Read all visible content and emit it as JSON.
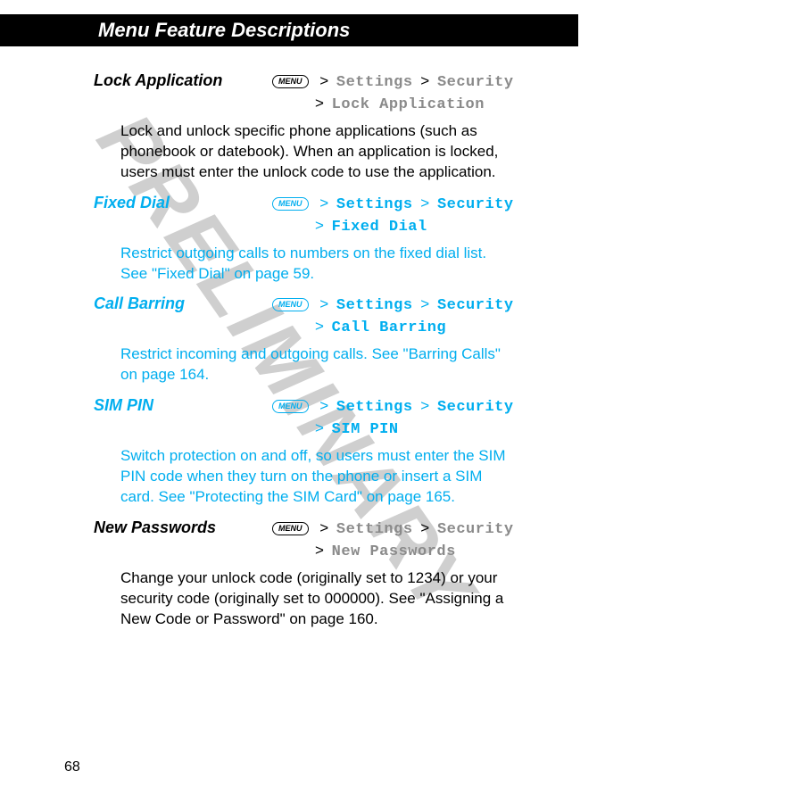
{
  "header": {
    "title": "Menu Feature Descriptions"
  },
  "menu_label": "MENU",
  "sep": ">",
  "watermark": "PRELIMINARY",
  "page_number": "68",
  "entries": [
    {
      "title": "Lock Application",
      "color": "black",
      "path1a": "Settings",
      "path1b": "Security",
      "path2": "Lock Application",
      "desc": "Lock and unlock specific phone applications (such as phonebook or datebook). When an application is locked, users must enter the unlock code to use the application."
    },
    {
      "title": "Fixed Dial",
      "color": "cyan",
      "path1a": "Settings",
      "path1b": "Security",
      "path2": "Fixed Dial",
      "desc": "Restrict outgoing calls to numbers on the fixed dial list. See \"Fixed Dial\" on page 59."
    },
    {
      "title": "Call Barring",
      "color": "cyan",
      "path1a": "Settings",
      "path1b": "Security",
      "path2": "Call Barring",
      "desc": "Restrict incoming and outgoing calls. See \"Barring Calls\" on page 164."
    },
    {
      "title": "SIM PIN",
      "color": "cyan",
      "path1a": "Settings",
      "path1b": "Security",
      "path2": "SIM PIN",
      "desc": "Switch protection on and off, so users must enter the SIM PIN code when they turn on the phone or insert a SIM card. See \"Protecting the SIM Card\" on page 165."
    },
    {
      "title": "New Passwords",
      "color": "black",
      "path1a": "Settings",
      "path1b": "Security",
      "path2": "New Passwords",
      "desc": "Change your unlock code (originally set to 1234) or your security code (originally set to 000000). See \"Assigning a New Code or Password\" on page 160."
    }
  ]
}
